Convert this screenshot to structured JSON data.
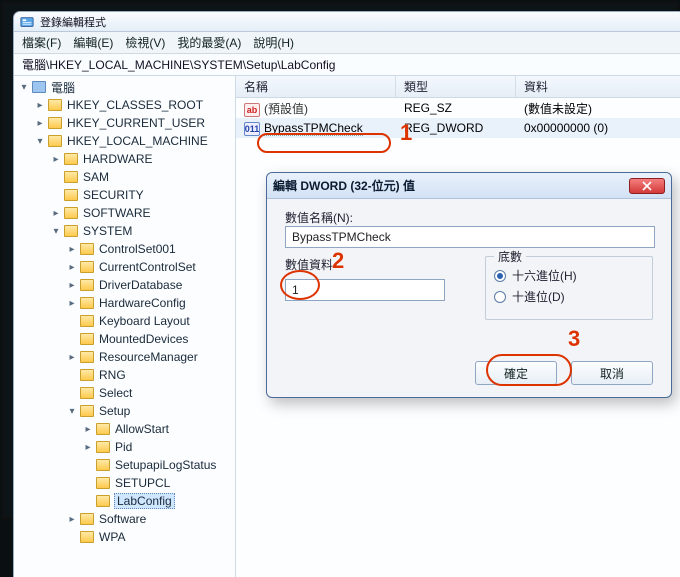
{
  "window": {
    "title": "登錄編輯程式"
  },
  "menu": {
    "file": "檔案(F)",
    "edit": "編輯(E)",
    "view": "檢視(V)",
    "favorites": "我的最愛(A)",
    "help": "說明(H)"
  },
  "address": "電腦\\HKEY_LOCAL_MACHINE\\SYSTEM\\Setup\\LabConfig",
  "tree": {
    "root": "電腦",
    "hkcr": "HKEY_CLASSES_ROOT",
    "hkcu": "HKEY_CURRENT_USER",
    "hklm": "HKEY_LOCAL_MACHINE",
    "hklm_children": {
      "hardware": "HARDWARE",
      "sam": "SAM",
      "security": "SECURITY",
      "software": "SOFTWARE",
      "system": "SYSTEM"
    },
    "system_children": {
      "cs001": "ControlSet001",
      "ccs": "CurrentControlSet",
      "drvdb": "DriverDatabase",
      "hwcfg": "HardwareConfig",
      "kbl": "Keyboard Layout",
      "md": "MountedDevices",
      "rm": "ResourceManager",
      "rng": "RNG",
      "select": "Select",
      "setup": "Setup"
    },
    "setup_children": {
      "allow": "AllowStart",
      "pid": "Pid",
      "sapi": "SetupapiLogStatus",
      "setupcl": "SETUPCL",
      "labconfig": "LabConfig"
    },
    "system_tail": {
      "software": "Software",
      "wpa": "WPA"
    }
  },
  "list": {
    "h_name": "名稱",
    "h_type": "類型",
    "h_data": "資料",
    "row1_name": "(預設值)",
    "row1_type": "REG_SZ",
    "row1_data": "(數值未設定)",
    "row2_name": "BypassTPMCheck",
    "row2_type": "REG_DWORD",
    "row2_data": "0x00000000 (0)"
  },
  "dialog": {
    "title": "編輯 DWORD (32-位元) 值",
    "name_label": "數值名稱(N):",
    "name_value": "BypassTPMCheck",
    "data_label": "數值資料",
    "data_value": "1",
    "base_label": "底數",
    "hex_label": "十六進位(H)",
    "dec_label": "十進位(D)",
    "ok": "確定",
    "cancel": "取消"
  },
  "annotations": {
    "a1": "1",
    "a2": "2",
    "a3": "3"
  }
}
